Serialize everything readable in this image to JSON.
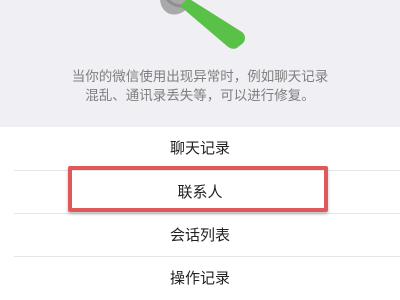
{
  "description": {
    "line1": "当你的微信使用出现异常时，例如聊天记录",
    "line2": "混乱、通讯录丢失等，可以进行修复。"
  },
  "icons": {
    "repair_tool": "wrench-icon"
  },
  "menu": {
    "items": [
      {
        "label": "聊天记录"
      },
      {
        "label": "联系人"
      },
      {
        "label": "会话列表"
      },
      {
        "label": "操作记录"
      }
    ]
  },
  "colors": {
    "highlight": "#e0595a",
    "wrench_green": "#5ac148",
    "wrench_gray": "#a9a9a9"
  }
}
